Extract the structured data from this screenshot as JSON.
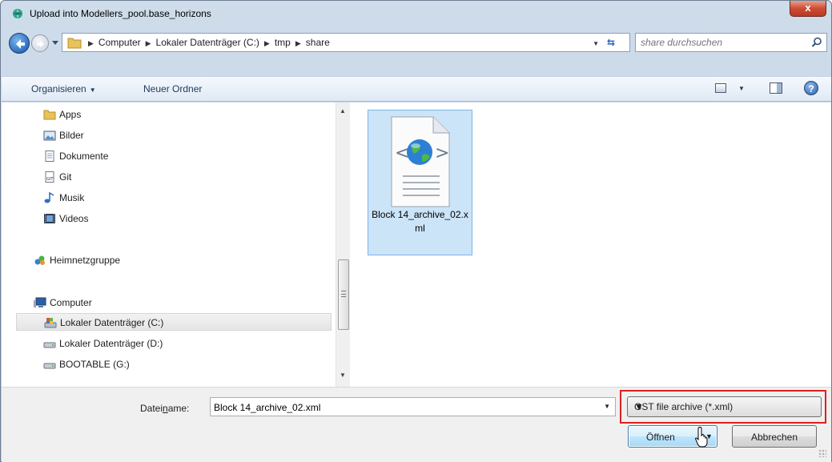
{
  "window": {
    "title": "Upload into Modellers_pool.base_horizons",
    "close_label": "x"
  },
  "address": {
    "crumbs": [
      "Computer",
      "Lokaler Datenträger (C:)",
      "tmp",
      "share"
    ],
    "search_placeholder": "share durchsuchen"
  },
  "toolbar": {
    "organize_label": "Organisieren",
    "new_folder_label": "Neuer Ordner",
    "help_label": "?"
  },
  "nav": {
    "items": [
      {
        "label": "Apps",
        "icon": "folder-icon"
      },
      {
        "label": "Bilder",
        "icon": "pictures-icon"
      },
      {
        "label": "Dokumente",
        "icon": "documents-icon"
      },
      {
        "label": "Git",
        "icon": "git-icon"
      },
      {
        "label": "Musik",
        "icon": "music-icon"
      },
      {
        "label": "Videos",
        "icon": "videos-icon"
      },
      {
        "label": "Heimnetzgruppe",
        "icon": "homegroup-icon"
      },
      {
        "label": "Computer",
        "icon": "computer-icon"
      },
      {
        "label": "Lokaler Datenträger (C:)",
        "icon": "system-drive-icon",
        "selected": true
      },
      {
        "label": "Lokaler Datenträger (D:)",
        "icon": "drive-icon"
      },
      {
        "label": "BOOTABLE (G:)",
        "icon": "drive-icon"
      }
    ]
  },
  "files": [
    {
      "name": "Block 14_archive_02.xml",
      "selected": true
    }
  ],
  "bottom": {
    "filename_label_pre": "Datei",
    "filename_label_accel": "n",
    "filename_label_post": "ame:",
    "filename_value": "Block 14_archive_02.xml",
    "filetype_value": "GST file archive (*.xml)",
    "open_label": "Öffnen",
    "cancel_label": "Abbrechen"
  }
}
